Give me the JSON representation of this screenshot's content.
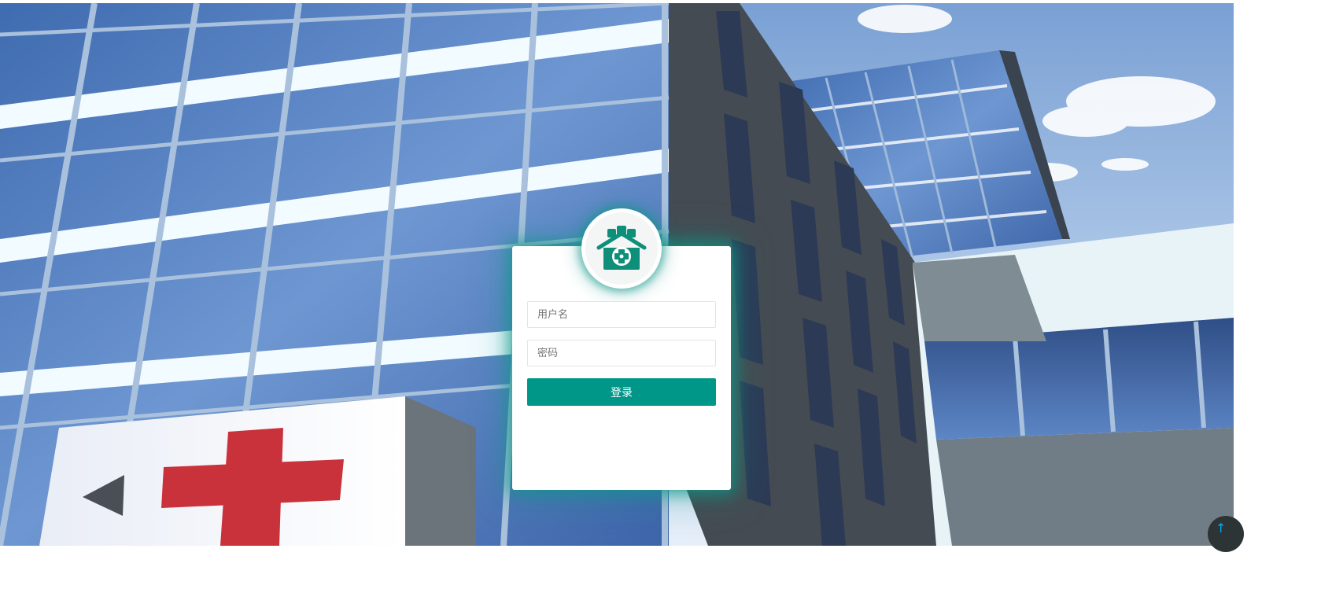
{
  "login": {
    "username_placeholder": "用户名",
    "password_placeholder": "密码",
    "submit_label": "登录"
  },
  "icons": {
    "logo": "hospital-logo-icon",
    "back_to_top": "arrow-up-icon"
  },
  "colors": {
    "accent": "#009688",
    "logo_green": "#0e8f7a",
    "cross_red": "#c9323a"
  }
}
